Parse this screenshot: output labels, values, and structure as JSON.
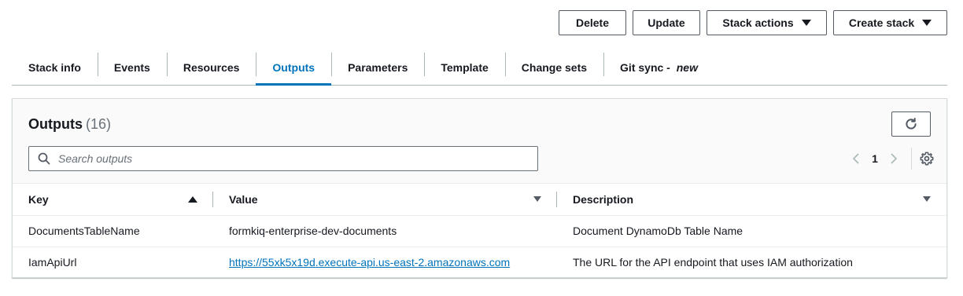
{
  "toolbar": {
    "delete_label": "Delete",
    "update_label": "Update",
    "stack_actions_label": "Stack actions",
    "create_stack_label": "Create stack"
  },
  "tabs": [
    {
      "label": "Stack info"
    },
    {
      "label": "Events"
    },
    {
      "label": "Resources"
    },
    {
      "label": "Outputs",
      "active": true
    },
    {
      "label": "Parameters"
    },
    {
      "label": "Template"
    },
    {
      "label": "Change sets"
    },
    {
      "label": "Git sync - ",
      "badge": "new"
    }
  ],
  "panel": {
    "title": "Outputs",
    "count": "(16)",
    "search_placeholder": "Search outputs",
    "current_page": "1"
  },
  "table": {
    "columns": [
      {
        "label": "Key"
      },
      {
        "label": "Value"
      },
      {
        "label": "Description"
      }
    ],
    "rows": [
      {
        "key": "DocumentsTableName",
        "value": "formkiq-enterprise-dev-documents",
        "description": "Document DynamoDb Table Name"
      },
      {
        "key": "IamApiUrl",
        "value": "https://55xk5x19d.execute-api.us-east-2.amazonaws.com",
        "description": "The URL for the API endpoint that uses IAM authorization"
      }
    ]
  },
  "colors": {
    "accent": "#0073bb",
    "border": "#545b64",
    "header_bg": "#fafafa"
  },
  "icons": [
    "caret-down-icon",
    "refresh-icon",
    "search-icon",
    "chevron-left-icon",
    "chevron-right-icon",
    "settings-gear-icon",
    "sort-ascending-icon",
    "sort-unsorted-icon"
  ]
}
